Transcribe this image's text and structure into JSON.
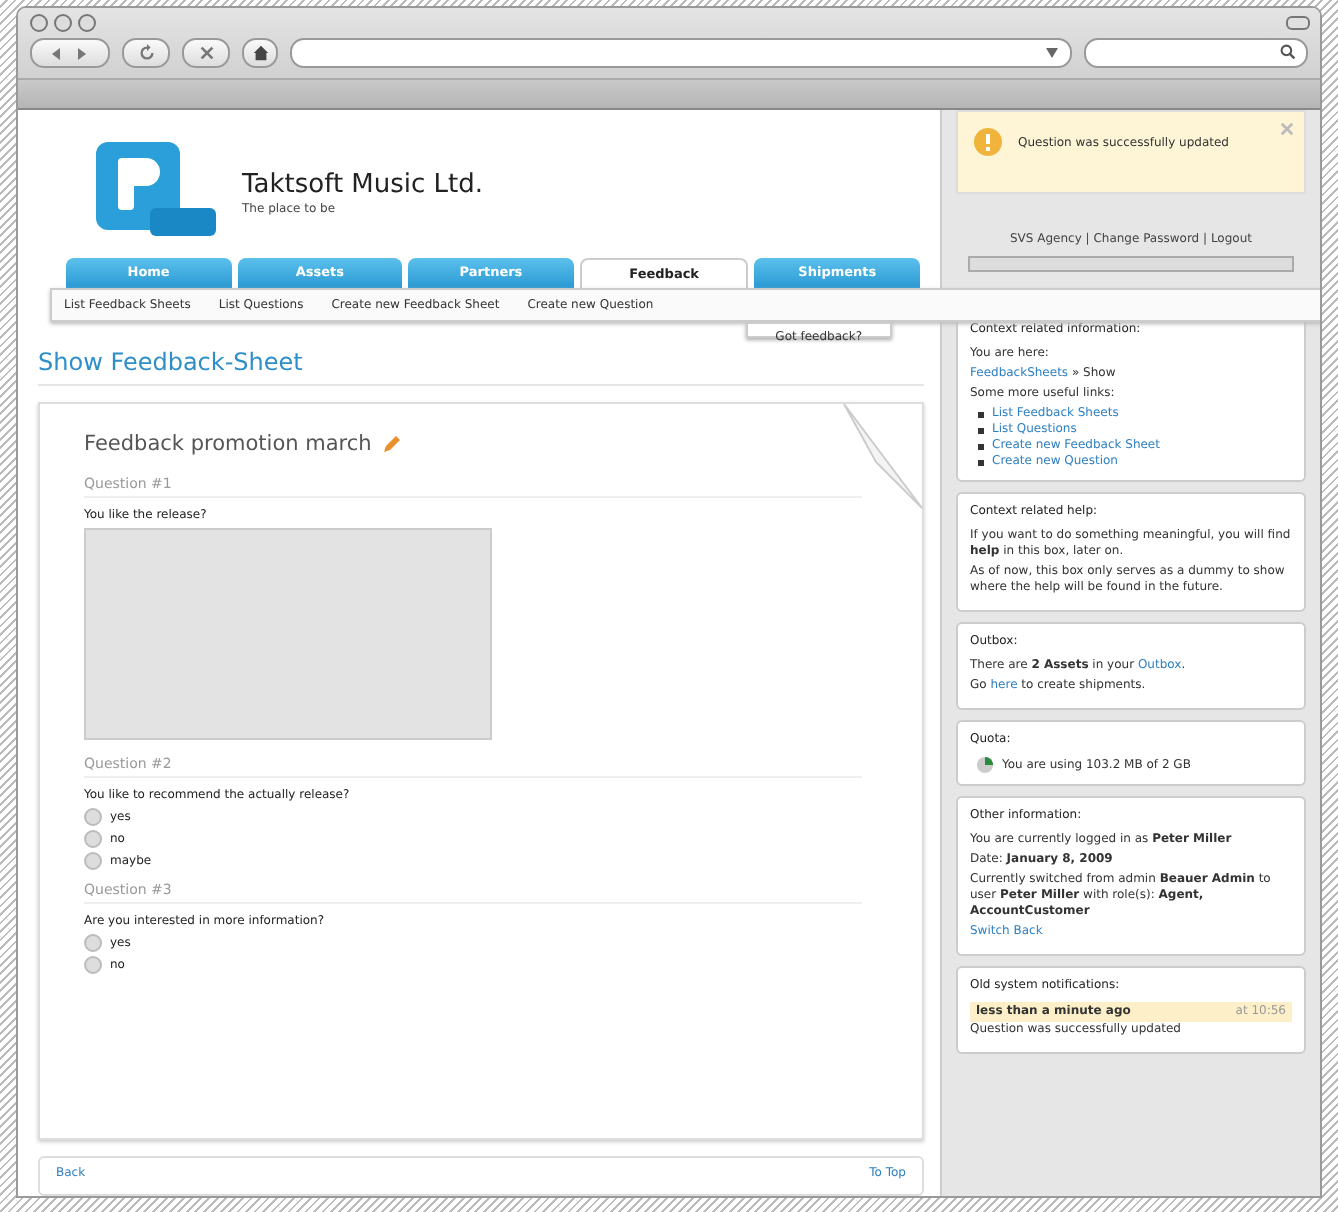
{
  "notification": {
    "text": "Question was successfully updated"
  },
  "header": {
    "company": "Taktsoft Music Ltd.",
    "tagline": "The place to be"
  },
  "tabs": [
    {
      "label": "Home",
      "selected": false
    },
    {
      "label": "Assets",
      "selected": false
    },
    {
      "label": "Partners",
      "selected": false
    },
    {
      "label": "Feedback",
      "selected": true
    },
    {
      "label": "Shipments",
      "selected": false
    }
  ],
  "subnav": [
    "List Feedback Sheets",
    "List Questions",
    "Create new Feedback Sheet",
    "Create new Question"
  ],
  "dropdown": {
    "label": "Got feedback?"
  },
  "account_links": "SVS Agency | Change Password | Logout",
  "page_title": "Show Feedback-Sheet",
  "sheet": {
    "title": "Feedback promotion march",
    "questions": [
      {
        "heading": "Question #1",
        "text": "You like the release?",
        "kind": "textarea"
      },
      {
        "heading": "Question #2",
        "text": "You like to recommend the actually release?",
        "kind": "radio",
        "options": [
          {
            "label": "yes",
            "selected": false
          },
          {
            "label": "no",
            "selected": false
          },
          {
            "label": "maybe",
            "selected": false
          }
        ]
      },
      {
        "heading": "Question #3",
        "text": "Are you interested in more information?",
        "kind": "radio",
        "options": [
          {
            "label": "yes",
            "selected": false
          },
          {
            "label": "no",
            "selected": false
          }
        ]
      }
    ]
  },
  "footer": {
    "back": "Back",
    "top": "To Top"
  },
  "boxes": [
    {
      "title": "Context related information:",
      "blocks": [
        {
          "kind": "para",
          "segments": [
            {
              "text": "You are here:",
              "link": false
            }
          ]
        },
        {
          "kind": "para",
          "segments": [
            {
              "text": "FeedbackSheets",
              "link": true
            },
            {
              "text": " » Show",
              "link": false
            }
          ]
        },
        {
          "kind": "para",
          "segments": [
            {
              "text": "Some more useful links:",
              "link": false
            }
          ]
        },
        {
          "kind": "links",
          "items": [
            "List Feedback Sheets",
            "List Questions",
            "Create new Feedback Sheet",
            "Create new Question"
          ]
        }
      ]
    },
    {
      "title": "Context related help:",
      "blocks": [
        {
          "kind": "para",
          "segments": [
            {
              "text": "If you want to do something meaningful, you will find **help** in this box, later on.",
              "link": false
            }
          ]
        },
        {
          "kind": "para",
          "segments": [
            {
              "text": "As of now, this box only serves as a dummy to show where the help will be found in the future.",
              "link": false
            }
          ]
        }
      ]
    },
    {
      "title": "Outbox:",
      "blocks": [
        {
          "kind": "para",
          "segments": [
            {
              "text": "There are **2 Assets** in your ",
              "link": false
            },
            {
              "text": "Outbox",
              "link": true
            },
            {
              "text": ".",
              "link": false
            }
          ]
        },
        {
          "kind": "para",
          "segments": [
            {
              "text": "Go ",
              "link": false
            },
            {
              "text": "here",
              "link": true
            },
            {
              "text": " to create shipments.",
              "link": false
            }
          ]
        }
      ]
    },
    {
      "title": "Quota:",
      "blocks": [
        {
          "kind": "quota",
          "text": "You are using 103.2 MB of 2 GB"
        }
      ]
    },
    {
      "title": "Other information:",
      "blocks": [
        {
          "kind": "para",
          "segments": [
            {
              "text": "You are currently logged in as **Peter Miller**",
              "link": false
            }
          ]
        },
        {
          "kind": "para",
          "segments": [
            {
              "text": "Date: **January 8, 2009**",
              "link": false
            }
          ]
        },
        {
          "kind": "para",
          "segments": [
            {
              "text": "Currently switched from admin **Beauer Admin** to user **Peter Miller** with role(s): **Agent, AccountCustomer**",
              "link": false
            }
          ]
        },
        {
          "kind": "para",
          "segments": [
            {
              "text": "Switch Back",
              "link": true
            }
          ]
        }
      ]
    },
    {
      "title": "Old system notifications:",
      "blocks": [
        {
          "kind": "notice",
          "age": "less than a minute ago",
          "time": "at 10:56",
          "text": "Question was successfully updated"
        }
      ]
    }
  ]
}
